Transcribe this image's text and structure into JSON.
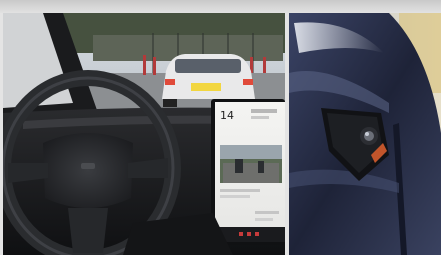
{
  "scene": {
    "left_photo": "tesla-cabin-view",
    "right_photo": "side-camera-close-up"
  },
  "screen": {
    "speed": "14",
    "label_top": "",
    "small_text": [
      "",
      ""
    ]
  },
  "car_ahead": {
    "plate": ""
  },
  "colors": {
    "sky": "#cfd6dd",
    "building": "#3f4a3f",
    "dash": "#1b1c1e",
    "wheel": "#25272a",
    "car_body": "#2c3350"
  }
}
